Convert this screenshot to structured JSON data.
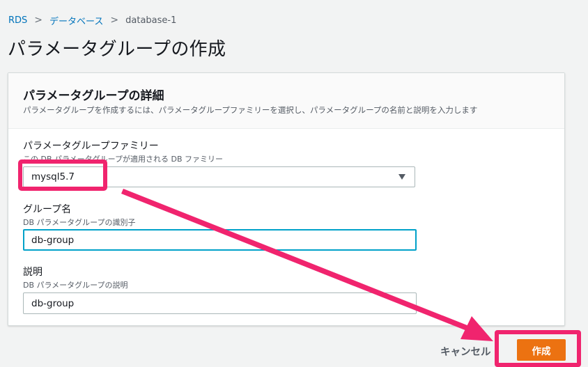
{
  "breadcrumb": {
    "items": [
      "RDS",
      "データベース",
      "database-1"
    ],
    "separator": ">"
  },
  "page_title": "パラメータグループの作成",
  "panel": {
    "title": "パラメータグループの詳細",
    "description": "パラメータグループを作成するには、パラメータグループファミリーを選択し、パラメータグループの名前と説明を入力します"
  },
  "fields": {
    "family": {
      "label": "パラメータグループファミリー",
      "description": "この DB パラメータグループが適用される DB ファミリー",
      "value": "mysql5.7"
    },
    "group_name": {
      "label": "グループ名",
      "description": "DB パラメータグループの識別子",
      "value": "db-group"
    },
    "description": {
      "label": "説明",
      "description": "DB パラメータグループの説明",
      "value": "db-group"
    }
  },
  "actions": {
    "cancel_label": "キャンセル",
    "create_label": "作成"
  },
  "colors": {
    "primary_button": "#ec7211",
    "link": "#0073bb",
    "annotation": "#f0246e",
    "focus_border": "#00a1c9"
  },
  "icons": {
    "breadcrumb_separator": "chevron-right-icon",
    "select_caret": "caret-down-icon"
  }
}
